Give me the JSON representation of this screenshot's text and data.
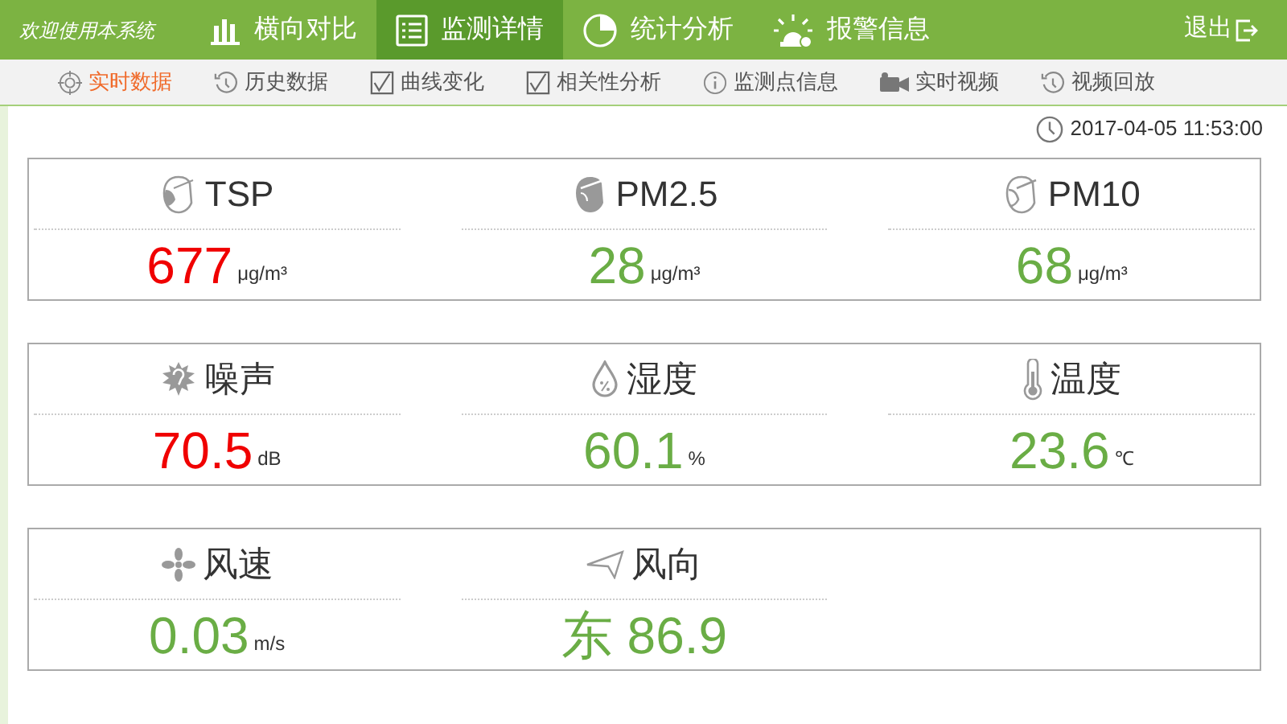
{
  "header": {
    "welcome": "欢迎使用本系统",
    "logout": "退出"
  },
  "nav": [
    {
      "label": "横向对比",
      "kind": "bars",
      "selected": false
    },
    {
      "label": "监测详情",
      "kind": "list",
      "selected": true
    },
    {
      "label": "统计分析",
      "kind": "pie",
      "selected": false
    },
    {
      "label": "报警信息",
      "kind": "alarm",
      "selected": false
    }
  ],
  "subnav": [
    {
      "label": "实时数据",
      "kind": "target",
      "selected": true
    },
    {
      "label": "历史数据",
      "kind": "history",
      "selected": false
    },
    {
      "label": "曲线变化",
      "kind": "check",
      "selected": false
    },
    {
      "label": "相关性分析",
      "kind": "check",
      "selected": false
    },
    {
      "label": "监测点信息",
      "kind": "info",
      "selected": false
    },
    {
      "label": "实时视频",
      "kind": "camera",
      "selected": false
    },
    {
      "label": "视频回放",
      "kind": "history",
      "selected": false
    }
  ],
  "timestamp": "2017-04-05 11:53:00",
  "cards": [
    {
      "metrics": [
        {
          "kind": "mask",
          "label": "TSP",
          "value": "677",
          "unit": "μg/m³",
          "alarm": true
        },
        {
          "kind": "mask-filled",
          "label": "PM2.5",
          "value": "28",
          "unit": "μg/m³",
          "alarm": false
        },
        {
          "kind": "mask-outline",
          "label": "PM10",
          "value": "68",
          "unit": "μg/m³",
          "alarm": false
        }
      ]
    },
    {
      "metrics": [
        {
          "kind": "noise",
          "label": "噪声",
          "value": "70.5",
          "unit": "dB",
          "alarm": true
        },
        {
          "kind": "drop",
          "label": "湿度",
          "value": "60.1",
          "unit": "%",
          "alarm": false
        },
        {
          "kind": "thermometer",
          "label": "温度",
          "value": "23.6",
          "unit": "℃",
          "alarm": false
        }
      ]
    },
    {
      "metrics": [
        {
          "kind": "fan",
          "label": "风速",
          "value": "0.03",
          "unit": "m/s",
          "alarm": false
        },
        {
          "kind": "arrow",
          "label": "风向",
          "value": "东 86.9",
          "alarm": false
        }
      ]
    }
  ]
}
